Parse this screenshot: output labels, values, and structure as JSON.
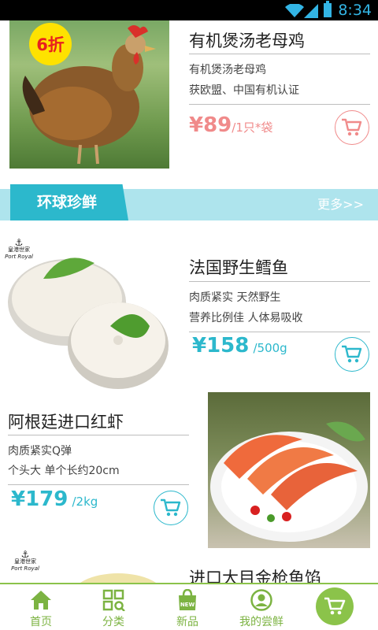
{
  "status_bar": {
    "time": "8:34"
  },
  "products_top": {
    "title": "有机煲汤老母鸡",
    "desc_line1": "有机煲汤老母鸡",
    "desc_line2": "获欧盟、中国有机认证",
    "price_symbol": "¥",
    "price": "89",
    "unit": "/1只*袋",
    "badge": "6折"
  },
  "section": {
    "title": "环球珍鲜",
    "more": "更多>>"
  },
  "products": [
    {
      "title": "法国野生鳕鱼",
      "desc_line1": "肉质紧实 天然野生",
      "desc_line2": "营养比例佳 人体易吸收",
      "price_symbol": "¥",
      "price": "158",
      "unit": "/500g",
      "logo_cn": "皇港世家",
      "logo_en": "Port Royal"
    },
    {
      "title": "阿根廷进口红虾",
      "desc_line1": "肉质紧实Q弹",
      "desc_line2": "个头大 单个长约20cm",
      "price_symbol": "¥",
      "price": "179",
      "unit": "/2kg"
    },
    {
      "title": "进口大目金枪鱼馅",
      "logo_cn": "皇港世家",
      "logo_en": "Port Royal"
    }
  ],
  "bottom_nav": {
    "items": [
      {
        "label": "首页",
        "icon": "home-icon"
      },
      {
        "label": "分类",
        "icon": "category-icon"
      },
      {
        "label": "新品",
        "icon": "new-bag-icon",
        "icon_text": "NEW"
      },
      {
        "label": "我的尝鲜",
        "icon": "user-icon"
      }
    ],
    "cart_icon": "cart-icon"
  },
  "colors": {
    "accent": "#2cb8cc",
    "section_band": "#aee4ed",
    "price_pink": "#f08a8a",
    "nav_green": "#8bc34a",
    "badge_yellow": "#fee200",
    "badge_text": "#e8201f"
  }
}
